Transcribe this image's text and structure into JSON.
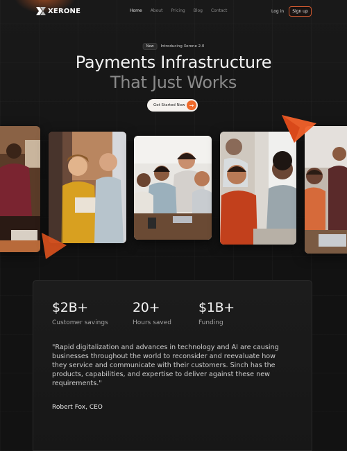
{
  "brand": {
    "name": "XERONE"
  },
  "nav": {
    "links": [
      "Home",
      "About",
      "Pricing",
      "Blog",
      "Contact"
    ],
    "active": "Home",
    "login": "Log in",
    "signup": "Sign up"
  },
  "hero": {
    "badge_tag": "New",
    "badge_text": "Introducing Xerone 2.0",
    "title_line1": "Payments Infrastructure",
    "title_line2": "That Just Works",
    "cta_label": "Get Started Now"
  },
  "stats": [
    {
      "value": "$2B+",
      "label": "Customer savings"
    },
    {
      "value": "20+",
      "label": "Hours saved"
    },
    {
      "value": "$1B+",
      "label": "Funding"
    }
  ],
  "testimonial": {
    "quote": "\"Rapid digitalization and advances in technology and AI are causing businesses throughout the world to reconsider and reevaluate how they service and communicate with their customers. Sinch has the products, capabilities, and expertise to deliver against these new requirements.\"",
    "author": "Robert Fox, CEO"
  },
  "colors": {
    "accent": "#ef6a2b",
    "background": "#121212",
    "panel": "#1c1c1c"
  },
  "icons": [
    "logo-mark-icon",
    "arrow-right-icon"
  ]
}
